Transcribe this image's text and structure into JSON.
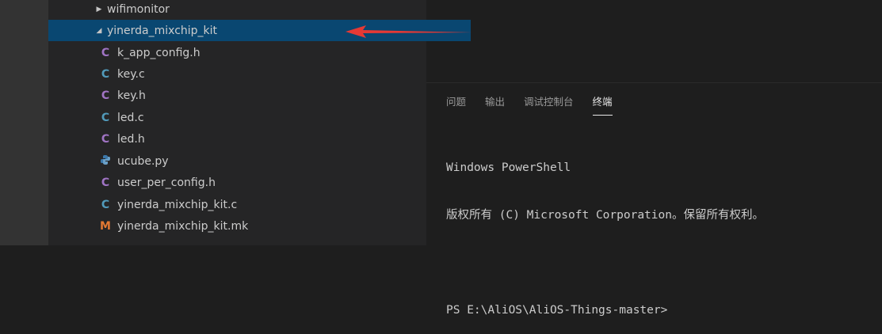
{
  "explorer": {
    "items": [
      {
        "label": "wifimonitor",
        "type": "folder",
        "expanded": false,
        "icon": "chevron-right-icon"
      },
      {
        "label": "yinerda_mixchip_kit",
        "type": "folder",
        "expanded": true,
        "selected": true,
        "icon": "chevron-down-icon"
      },
      {
        "label": "k_app_config.h",
        "type": "file",
        "icon": "c-header-icon",
        "glyph": "C"
      },
      {
        "label": "key.c",
        "type": "file",
        "icon": "c-source-icon",
        "glyph": "C"
      },
      {
        "label": "key.h",
        "type": "file",
        "icon": "c-header-icon",
        "glyph": "C"
      },
      {
        "label": "led.c",
        "type": "file",
        "icon": "c-source-icon",
        "glyph": "C"
      },
      {
        "label": "led.h",
        "type": "file",
        "icon": "c-header-icon",
        "glyph": "C"
      },
      {
        "label": "ucube.py",
        "type": "file",
        "icon": "python-icon",
        "glyph": "🐍"
      },
      {
        "label": "user_per_config.h",
        "type": "file",
        "icon": "c-header-icon",
        "glyph": "C"
      },
      {
        "label": "yinerda_mixchip_kit.c",
        "type": "file",
        "icon": "c-source-icon",
        "glyph": "C"
      },
      {
        "label": "yinerda_mixchip_kit.mk",
        "type": "file",
        "icon": "makefile-icon",
        "glyph": "M"
      }
    ]
  },
  "panel": {
    "tabs": [
      {
        "label": "问题",
        "active": false
      },
      {
        "label": "输出",
        "active": false
      },
      {
        "label": "调试控制台",
        "active": false
      },
      {
        "label": "终端",
        "active": true
      }
    ]
  },
  "terminal": {
    "lines": [
      "Windows PowerShell",
      "版权所有 (C) Microsoft Corporation。保留所有权利。",
      "",
      "PS E:\\AliOS\\AliOS-Things-master>"
    ]
  },
  "colors": {
    "selection": "#094771",
    "annotation_arrow": "#e53935",
    "c_source": "#519aba",
    "c_header": "#a074c4",
    "makefile": "#e37933",
    "python": "#3c78aa"
  }
}
